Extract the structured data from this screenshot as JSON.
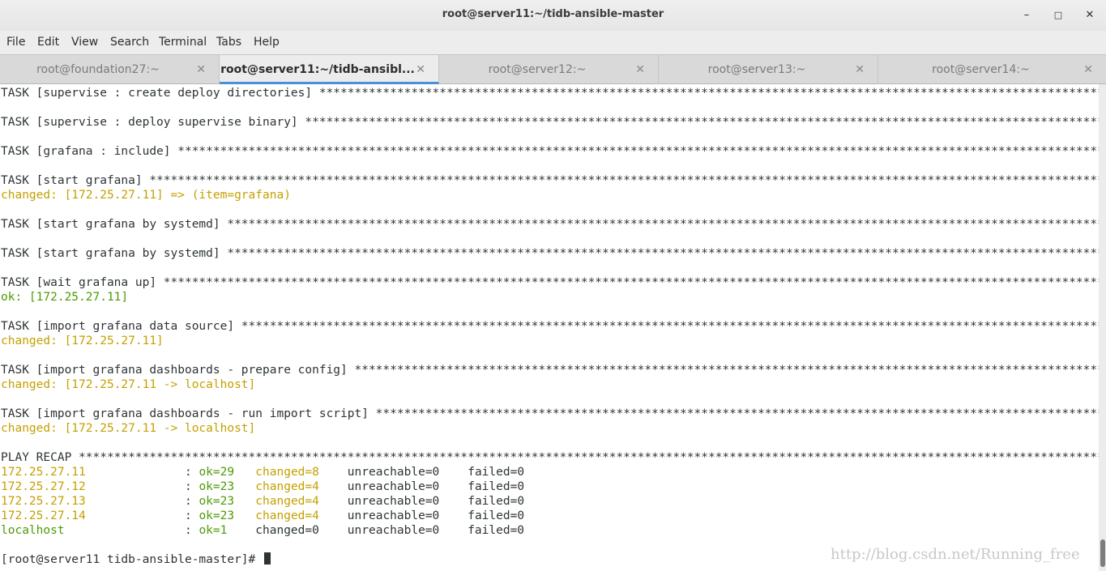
{
  "window": {
    "title": "root@server11:~/tidb-ansible-master",
    "minimize_glyph": "–",
    "maximize_glyph": "□",
    "close_glyph": "✕"
  },
  "menu": {
    "items": [
      {
        "label": "File"
      },
      {
        "label": "Edit"
      },
      {
        "label": "View"
      },
      {
        "label": "Search"
      },
      {
        "label": "Terminal"
      },
      {
        "label": "Tabs"
      },
      {
        "label": "Help"
      }
    ]
  },
  "tabs": [
    {
      "label": "root@foundation27:~",
      "close": "✕",
      "active": false
    },
    {
      "label": "root@server11:~/tidb-ansibl...",
      "close": "✕",
      "active": true
    },
    {
      "label": "root@server12:~",
      "close": "✕",
      "active": false
    },
    {
      "label": "root@server13:~",
      "close": "✕",
      "active": false
    },
    {
      "label": "root@server14:~",
      "close": "✕",
      "active": false
    }
  ],
  "terminal": {
    "lines": [
      {
        "text": "TASK [supervise : create deploy directories] *****************************************************************************************************************************"
      },
      {
        "text": ""
      },
      {
        "text": "TASK [supervise : deploy supervise binary] *******************************************************************************************************************************"
      },
      {
        "text": ""
      },
      {
        "text": "TASK [grafana : include] **************************************************************************************************************************************************************"
      },
      {
        "text": ""
      },
      {
        "text": "TASK [start grafana] ******************************************************************************************************************************************************************"
      },
      {
        "text": "changed: [172.25.27.11] => (item=grafana)"
      },
      {
        "text": ""
      },
      {
        "text": "TASK [start grafana by systemd] ********************************************************************************************************************************************"
      },
      {
        "text": ""
      },
      {
        "text": "TASK [start grafana by systemd] ********************************************************************************************************************************************"
      },
      {
        "text": ""
      },
      {
        "text": "TASK [wait grafana up] ****************************************************************************************************************************************************************"
      },
      {
        "text": "ok: [172.25.27.11]"
      },
      {
        "text": ""
      },
      {
        "text": "TASK [import grafana data source] *****************************************************************************************************************************************"
      },
      {
        "text": "changed: [172.25.27.11]"
      },
      {
        "text": ""
      },
      {
        "text": "TASK [import grafana dashboards - prepare config] *************************************************************************************************************************"
      },
      {
        "text": "changed: [172.25.27.11 -> localhost]"
      },
      {
        "text": ""
      },
      {
        "text": "TASK [import grafana dashboards - run import script] **********************************************************************************************************************"
      },
      {
        "text": "changed: [172.25.27.11 -> localhost]"
      },
      {
        "text": ""
      },
      {
        "text": "PLAY RECAP ****************************************************************************************************************************************************************************************"
      }
    ],
    "recap": [
      {
        "host": "172.25.27.11  ",
        "sep": "            : ",
        "ok": "ok=29",
        "ok_pad": "   ",
        "changed": "changed=8",
        "changed_pad": "    ",
        "unreachable": "unreachable=0",
        "un_pad": "    ",
        "failed": "failed=0",
        "host_color": "yellow",
        "changed_color": "yellow"
      },
      {
        "host": "172.25.27.12  ",
        "sep": "            : ",
        "ok": "ok=23",
        "ok_pad": "   ",
        "changed": "changed=4",
        "changed_pad": "    ",
        "unreachable": "unreachable=0",
        "un_pad": "    ",
        "failed": "failed=0",
        "host_color": "yellow",
        "changed_color": "yellow"
      },
      {
        "host": "172.25.27.13  ",
        "sep": "            : ",
        "ok": "ok=23",
        "ok_pad": "   ",
        "changed": "changed=4",
        "changed_pad": "    ",
        "unreachable": "unreachable=0",
        "un_pad": "    ",
        "failed": "failed=0",
        "host_color": "yellow",
        "changed_color": "yellow"
      },
      {
        "host": "172.25.27.14  ",
        "sep": "            : ",
        "ok": "ok=23",
        "ok_pad": "   ",
        "changed": "changed=4",
        "changed_pad": "    ",
        "unreachable": "unreachable=0",
        "un_pad": "    ",
        "failed": "failed=0",
        "host_color": "yellow",
        "changed_color": "yellow"
      },
      {
        "host": "localhost     ",
        "sep": "            : ",
        "ok": "ok=1",
        "ok_pad": "    ",
        "changed": "changed=0",
        "changed_pad": "    ",
        "unreachable": "unreachable=0",
        "un_pad": "    ",
        "failed": "failed=0",
        "host_color": "green",
        "changed_color": "plain"
      }
    ],
    "prompt": "[root@server11 tidb-ansible-master]# ",
    "colors": {
      "changed": "#c4a000",
      "ok": "#4e9a06",
      "text": "#2e3436"
    }
  },
  "watermark": "http://blog.csdn.net/Running_free"
}
